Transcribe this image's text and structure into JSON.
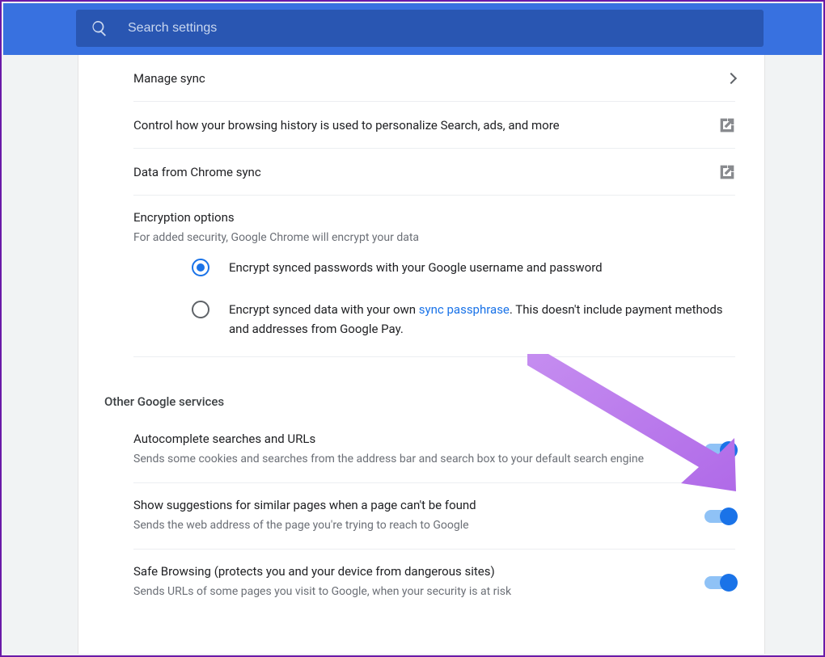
{
  "search": {
    "placeholder": "Search settings"
  },
  "rows": {
    "manage_sync": "Manage sync",
    "control_history": "Control how your browsing history is used to personalize Search, ads, and more",
    "chrome_sync_data": "Data from Chrome sync"
  },
  "encryption": {
    "title": "Encryption options",
    "subtitle": "For added security, Google Chrome will encrypt your data",
    "opt1": "Encrypt synced passwords with your Google username and password",
    "opt2_a": "Encrypt synced data with your own ",
    "opt2_link": "sync passphrase",
    "opt2_b": ". This doesn't include payment methods and addresses from Google Pay."
  },
  "section2": {
    "heading": "Other Google services",
    "items": [
      {
        "title": "Autocomplete searches and URLs",
        "sub": "Sends some cookies and searches from the address bar and search box to your default search engine"
      },
      {
        "title": "Show suggestions for similar pages when a page can't be found",
        "sub": "Sends the web address of the page you're trying to reach to Google"
      },
      {
        "title": "Safe Browsing (protects you and your device from dangerous sites)",
        "sub": "Sends URLs of some pages you visit to Google, when your security is at risk"
      }
    ]
  }
}
